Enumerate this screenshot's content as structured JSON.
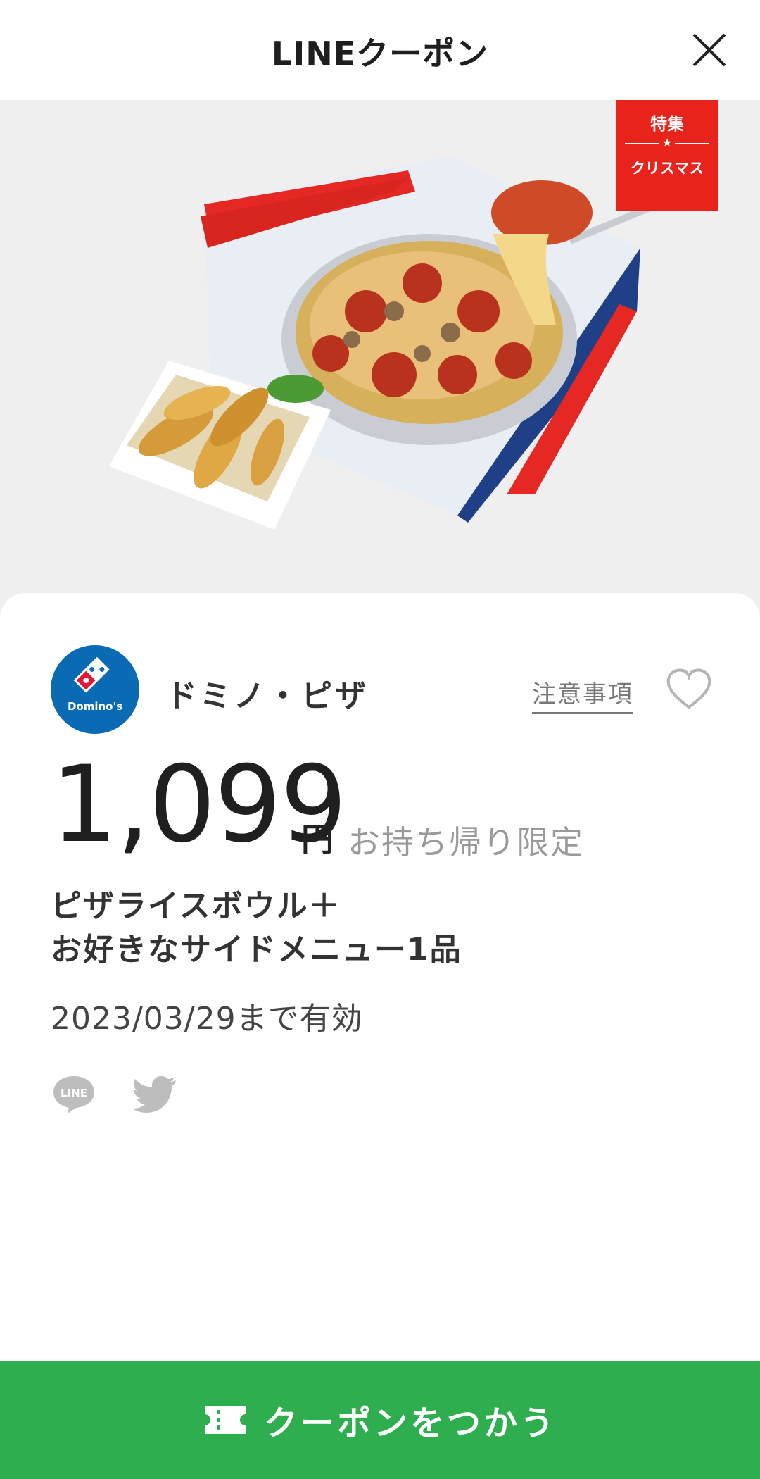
{
  "header": {
    "title": "LINEクーポン",
    "close_icon": "close-icon"
  },
  "hero": {
    "ribbon_top": "特集",
    "ribbon_star": "★",
    "ribbon_bottom": "クリスマス"
  },
  "shop": {
    "name": "ドミノ・ピザ",
    "logo_text": "Domino's",
    "notice_label": "注意事項"
  },
  "offer": {
    "price": "1,099",
    "currency": "円",
    "condition": "お持ち帰り限定",
    "description_line1": "ピザライスボウル＋",
    "description_line2": "お好きなサイドメニュー1品",
    "valid_until": "2023/03/29まで有効"
  },
  "share": {
    "line_label": "LINE",
    "twitter_icon": "twitter-icon"
  },
  "action": {
    "use_label": "クーポンをつかう",
    "icon": "ticket-icon"
  },
  "colors": {
    "green": "#2fae4f",
    "ribbon_red": "#e8231c",
    "domino_blue": "#0a6ab3"
  }
}
